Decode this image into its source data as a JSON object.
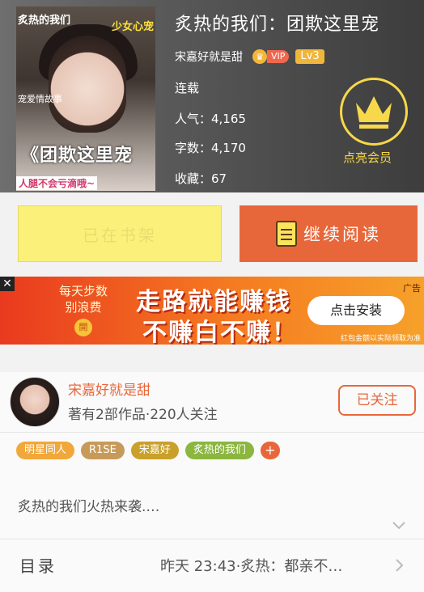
{
  "book": {
    "title": "炙热的我们：团欺这里宠",
    "author": "宋嘉好就是甜",
    "vip_label": "VIP",
    "level": "Lv3",
    "status": "连载",
    "popularity_label": "人气：4,165",
    "words_label": "字数：4,170",
    "favorites_label": "收藏：67"
  },
  "cover": {
    "top_left_text": "炙热的我们",
    "top_right_text": "少女心宠",
    "side_text": "宠爱情故事",
    "big_text": "《团欺这里宠",
    "bottom_text": "人腿不会亏滴哦~"
  },
  "membership": {
    "label": "点亮会员",
    "icon": "crown-icon"
  },
  "actions": {
    "shelf_label": "已在书架",
    "read_label": "继续阅读"
  },
  "ad": {
    "left_line1": "每天步数",
    "left_line2": "别浪费",
    "left_coin": "開",
    "headline1": "走路就能赚钱",
    "headline2": "不赚白不赚！",
    "install_label": "点击安装",
    "tag": "广告",
    "footnote": "红包金额以实际领取为准"
  },
  "author_card": {
    "name": "宋嘉好就是甜",
    "info": "著有2部作品·220人关注",
    "follow_label": "已关注"
  },
  "tags": [
    {
      "label": "明星同人",
      "color": "#f1a73a"
    },
    {
      "label": "R1SE",
      "color": "#c79a5a"
    },
    {
      "label": "宋嘉好",
      "color": "#c9a02a"
    },
    {
      "label": "炙热的我们",
      "color": "#8bb63f"
    }
  ],
  "tag_plus": "+",
  "intro": "炙热的我们火热来袭.…",
  "toc": {
    "label": "目录",
    "latest": "昨天 23:43·炙热：都亲不…"
  },
  "colors": {
    "accent": "#e8673a",
    "member_gold": "#f6d84a",
    "shelf_bg": "#fbf07a"
  }
}
